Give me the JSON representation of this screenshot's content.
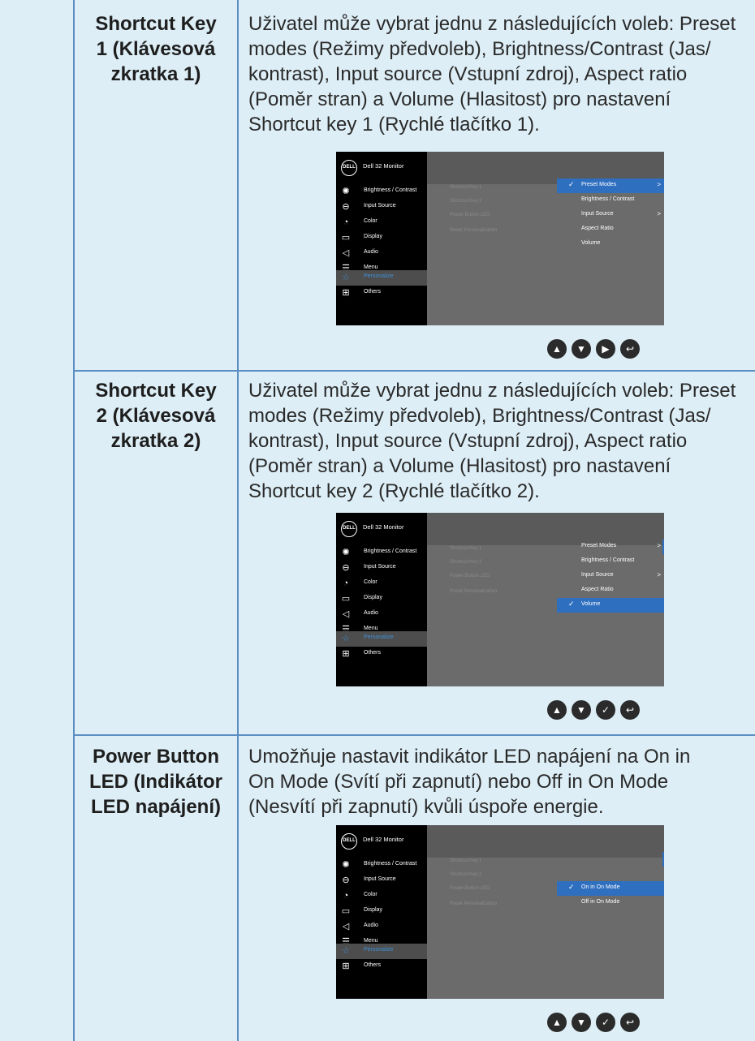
{
  "rows": [
    {
      "label": "Shortcut Key 1 (Klávesová zkratka 1)",
      "label_lines": [
        "Shortcut Key",
        "1 (Klávesová",
        "zkratka 1)"
      ],
      "desc_lines": [
        "Uživatel může vybrat jednu z následujících voleb: Preset",
        "modes (Režimy předvoleb), Brightness/Contrast (Jas/",
        "kontrast), Input source (Vstupní zdroj), Aspect ratio",
        "(Poměr stran) a Volume (Hlasitost) pro nastavení",
        "Shortcut key 1 (Rychlé tlačítko 1)."
      ]
    },
    {
      "label": "Shortcut Key 2 (Klávesová zkratka 2)",
      "label_lines": [
        "Shortcut Key",
        "2 (Klávesová",
        "zkratka 2)"
      ],
      "desc_lines": [
        "Uživatel může vybrat jednu z následujících voleb: Preset",
        "modes (Režimy předvoleb), Brightness/Contrast (Jas/",
        "kontrast), Input source (Vstupní zdroj), Aspect ratio",
        "(Poměr stran) a Volume (Hlasitost) pro nastavení",
        "Shortcut key 2 (Rychlé tlačítko 2)."
      ]
    },
    {
      "label": "Power Button LED (Indikátor LED napájení)",
      "label_lines": [
        "Power Button",
        "LED (Indikátor",
        "LED napájení)"
      ],
      "desc_parts": [
        "Umožňuje nastavit indikátor LED napájení na ",
        "On in On Mode (Svítí při zapnutí)",
        " nebo ",
        "Off in On Mode (Nesvítí při zapnutí)",
        " kvůli úspoře energie."
      ],
      "desc_lines": [
        "Umožňuje nastavit indikátor LED napájení na On in",
        "On Mode (Svítí při zapnutí) nebo Off in On Mode",
        "(Nesvítí při zapnutí) kvůli úspoře energie."
      ]
    }
  ],
  "osd": {
    "logo": "DELL",
    "title": "Dell 32 Monitor",
    "menu": [
      {
        "label": "Brightness / Contrast",
        "icon": "brightness-icon"
      },
      {
        "label": "Input Source",
        "icon": "input-source-icon"
      },
      {
        "label": "Color",
        "icon": "color-icon"
      },
      {
        "label": "Display",
        "icon": "display-icon"
      },
      {
        "label": "Audio",
        "icon": "audio-icon"
      },
      {
        "label": "Menu",
        "icon": "menu-icon"
      },
      {
        "label": "Personalize",
        "icon": "star-icon"
      },
      {
        "label": "Others",
        "icon": "others-icon"
      }
    ],
    "submenu": [
      "Shortcut Key 1",
      "Shortcut Key 2",
      "Power Button LED",
      "Reset Personalization"
    ],
    "shortcut_options": [
      "Preset Modes",
      "Brightness / Contrast",
      "Input Source",
      "Aspect Ratio",
      "Volume"
    ],
    "led_options": [
      "On in On Mode",
      "Off in On Mode"
    ]
  },
  "nav_icons": [
    "up-icon",
    "down-icon",
    "right-icon",
    "back-icon"
  ],
  "colors": {
    "page_background": "#ddeef6",
    "divider": "#5b8ec2",
    "osd_highlight": "#2f6fc0",
    "osd_selected_text": "#3f8fd8"
  }
}
